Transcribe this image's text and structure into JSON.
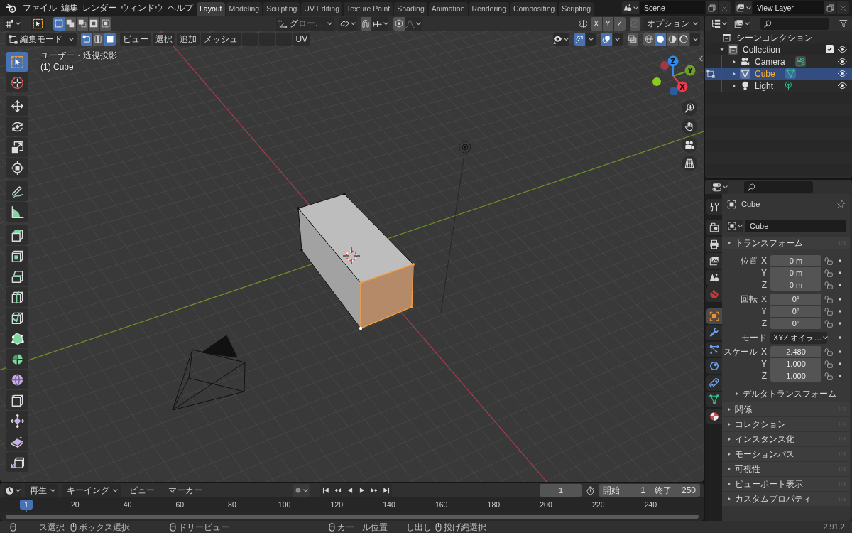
{
  "topbar": {
    "menus": [
      "ファイル",
      "編集",
      "レンダー",
      "ウィンドウ",
      "ヘルプ"
    ],
    "workspaces": [
      {
        "label": "Layout",
        "selected": true
      },
      {
        "label": "Modeling",
        "selected": false
      },
      {
        "label": "Sculpting",
        "selected": false
      },
      {
        "label": "UV Editing",
        "selected": false
      },
      {
        "label": "Texture Paint",
        "selected": false
      },
      {
        "label": "Shading",
        "selected": false
      },
      {
        "label": "Animation",
        "selected": false
      },
      {
        "label": "Rendering",
        "selected": false
      },
      {
        "label": "Compositing",
        "selected": false
      },
      {
        "label": "Scripting",
        "selected": false
      }
    ],
    "scene": "Scene",
    "view_layer": "View Layer"
  },
  "viewport": {
    "tool_settings": {
      "select_modes": [
        {
          "selected": true
        },
        {
          "selected": false
        },
        {
          "selected": false
        },
        {
          "selected": false
        },
        {
          "selected": false
        }
      ],
      "orientation": "グロー…",
      "snap": false,
      "proportional_editing": false,
      "mirror_axes": [
        {
          "label": "X",
          "selected": false
        },
        {
          "label": "Y",
          "selected": false
        },
        {
          "label": "Z",
          "selected": false
        }
      ],
      "auto_merge": false,
      "options": "オプション"
    },
    "header": {
      "mode": "編集モード",
      "select_modes": [
        {
          "selected": true
        },
        {
          "selected": false
        },
        {
          "selected": true
        }
      ],
      "menus": [
        "ビュー",
        "選択",
        "追加",
        "メッシュ"
      ],
      "uv_menu": "UV",
      "gizmos": true,
      "overlays": true,
      "xray": false,
      "shading": [
        {
          "selected": false
        },
        {
          "selected": true
        },
        {
          "selected": false
        },
        {
          "selected": false
        }
      ]
    },
    "view_info": [
      "ユーザー・透視投影",
      "(1) Cube"
    ],
    "toolbar": [
      {
        "tools": [
          {
            "selected": true
          },
          {
            "selected": false
          }
        ]
      },
      {
        "tools": [
          {
            "selected": false
          },
          {
            "selected": false
          },
          {
            "selected": false
          },
          {
            "selected": false
          }
        ]
      },
      {
        "tools": [
          {
            "selected": false
          },
          {
            "selected": false
          }
        ]
      },
      {
        "tools": [
          {
            "selected": false
          },
          {
            "selected": false
          },
          {
            "selected": false
          },
          {
            "selected": false
          },
          {
            "selected": false
          },
          {
            "selected": false
          },
          {
            "selected": false
          },
          {
            "selected": false
          },
          {
            "selected": false
          },
          {
            "selected": false
          },
          {
            "selected": false
          },
          {
            "selected": false
          }
        ]
      }
    ],
    "nav_gizmo": {
      "axes": [
        {
          "label": "X",
          "color": "#f0384e"
        },
        {
          "label": "Y",
          "color": "#6f9f27"
        },
        {
          "label": "Z",
          "color": "#2f8bef"
        }
      ],
      "negative_axes": [
        {
          "color": "#9c3b47"
        },
        {
          "color": "#8bcb1b"
        },
        {
          "color": "#2b5c9b"
        }
      ]
    }
  },
  "outliner": {
    "tree": [
      {
        "label": "シーンコレクション",
        "kind": "scene_collection",
        "selected": false,
        "children": [
          {
            "label": "Collection",
            "kind": "collection",
            "selected": false,
            "expanded": true,
            "checked": true,
            "visible": true,
            "children": [
              {
                "label": "Camera",
                "kind": "camera",
                "expanded": false,
                "selected": false,
                "edit_mode": false,
                "visible": true
              },
              {
                "label": "Cube",
                "kind": "mesh",
                "expanded": false,
                "selected": true,
                "edit_mode": true,
                "visible": true
              },
              {
                "label": "Light",
                "kind": "light",
                "expanded": false,
                "selected": false,
                "edit_mode": false,
                "visible": true
              }
            ]
          }
        ]
      }
    ]
  },
  "properties": {
    "tab_groups": [
      {
        "tabs": [
          {
            "selected": false
          }
        ]
      },
      {
        "tabs": [
          {
            "selected": false
          },
          {
            "selected": false
          },
          {
            "selected": false
          },
          {
            "selected": false
          },
          {
            "selected": false
          }
        ]
      },
      {
        "tabs": [
          {
            "selected": true
          },
          {
            "selected": false
          },
          {
            "selected": false
          },
          {
            "selected": false
          },
          {
            "selected": false
          },
          {
            "selected": false
          },
          {
            "selected": false
          }
        ]
      }
    ],
    "context": "Cube",
    "pinned": false,
    "datablock": "Cube",
    "panels": [
      {
        "title": "トランスフォーム",
        "expanded": true,
        "groups": [
          {
            "kind": "vector",
            "label": "位置",
            "rows": [
              {
                "axis": "X",
                "value": "0 m",
                "locked": false
              },
              {
                "axis": "Y",
                "value": "0 m",
                "locked": false
              },
              {
                "axis": "Z",
                "value": "0 m",
                "locked": false
              }
            ]
          },
          {
            "kind": "vector",
            "label": "回転",
            "rows": [
              {
                "axis": "X",
                "value": "0°",
                "locked": false
              },
              {
                "axis": "Y",
                "value": "0°",
                "locked": false
              },
              {
                "axis": "Z",
                "value": "0°",
                "locked": false
              }
            ]
          },
          {
            "kind": "dropdown",
            "label": "モード",
            "value": "XYZ オイラ…"
          },
          {
            "kind": "vector",
            "label": "スケール",
            "rows": [
              {
                "axis": "X",
                "value": "2.480",
                "locked": false
              },
              {
                "axis": "Y",
                "value": "1.000",
                "locked": false
              },
              {
                "axis": "Z",
                "value": "1.000",
                "locked": false
              }
            ]
          }
        ],
        "subpanels": [
          {
            "title": "デルタトランスフォーム",
            "expanded": false
          }
        ]
      },
      {
        "title": "関係",
        "expanded": false
      },
      {
        "title": "コレクション",
        "expanded": false
      },
      {
        "title": "インスタンス化",
        "expanded": false
      },
      {
        "title": "モーションパス",
        "expanded": false
      },
      {
        "title": "可視性",
        "expanded": false
      },
      {
        "title": "ビューポート表示",
        "expanded": false
      },
      {
        "title": "カスタムプロパティ",
        "expanded": false
      }
    ]
  },
  "timeline": {
    "menus": [
      {
        "kind": "dropdown",
        "label": "再生"
      },
      {
        "kind": "dropdown",
        "label": "キーイング"
      },
      {
        "kind": "menu",
        "label": "ビュー"
      },
      {
        "kind": "menu",
        "label": "マーカー"
      }
    ],
    "auto_keying": false,
    "current_frame": "1",
    "start": {
      "label": "開始",
      "value": "1"
    },
    "end": {
      "label": "終了",
      "value": "250"
    },
    "ruler": {
      "current": "1",
      "labels": [
        "20",
        "40",
        "60",
        "80",
        "100",
        "120",
        "140",
        "160",
        "180",
        "200",
        "220",
        "240"
      ]
    }
  },
  "status_bar": {
    "hints": [
      {
        "kind": "mouse",
        "label": "ス選択"
      },
      {
        "kind": "mouse",
        "label": "ボックス選択"
      },
      {
        "kind": "mouse",
        "label": "ドリービュー"
      },
      {
        "kind": "mouse",
        "label": "カー"
      },
      {
        "kind": "text",
        "label": "ル位置"
      },
      {
        "kind": "text",
        "label": "し出し"
      },
      {
        "kind": "mouse",
        "label": "投げ縄選択"
      }
    ],
    "version": "2.91.2"
  }
}
